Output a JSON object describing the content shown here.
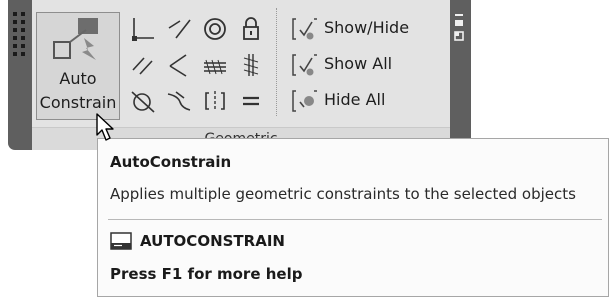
{
  "ribbon": {
    "panel_title": "Geometric",
    "auto_constrain": {
      "line1": "Auto",
      "line2": "Constrain"
    },
    "tools": [
      {
        "icon": "coincident-icon"
      },
      {
        "icon": "collinear-icon"
      },
      {
        "icon": "concentric-icon"
      },
      {
        "icon": "fix-icon"
      },
      {
        "icon": "parallel-icon"
      },
      {
        "icon": "perpendicular-icon"
      },
      {
        "icon": "horizontal-icon"
      },
      {
        "icon": "vertical-icon"
      },
      {
        "icon": "tangent-icon"
      },
      {
        "icon": "smooth-icon"
      },
      {
        "icon": "symmetric-icon"
      },
      {
        "icon": "equal-icon"
      }
    ],
    "links": [
      {
        "label": "Show/Hide",
        "icon": "show-hide-icon"
      },
      {
        "label": "Show All",
        "icon": "show-all-icon"
      },
      {
        "label": "Hide All",
        "icon": "hide-all-icon"
      }
    ]
  },
  "tooltip": {
    "title": "AutoConstrain",
    "description": "Applies multiple geometric constraints to the selected objects",
    "command": "AUTOCONSTRAIN",
    "help": "Press F1 for more help"
  }
}
